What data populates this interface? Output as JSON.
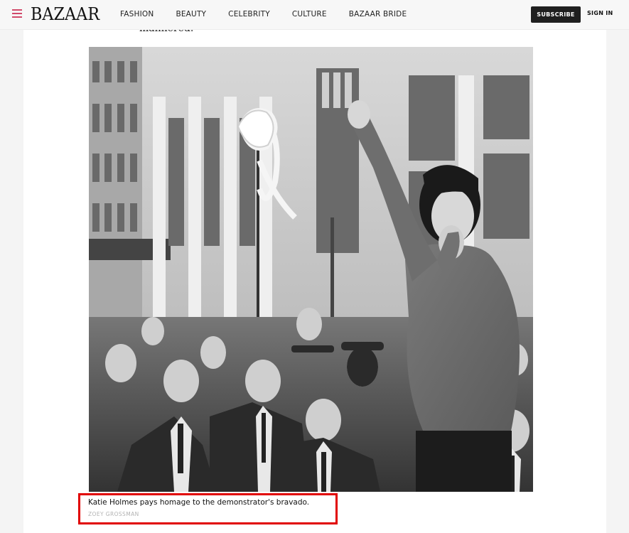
{
  "header": {
    "logo": "BAZAAR",
    "nav": [
      "FASHION",
      "BEAUTY",
      "CELEBRITY",
      "CULTURE",
      "BAZAAR BRIDE"
    ],
    "subscribe_label": "SUBSCRIBE",
    "sign_in_label": "SIGN IN",
    "accent_color": "#d14a6b"
  },
  "article": {
    "prev_text_fragment": "mannered.",
    "caption": "Katie Holmes pays homage to the demonstrator's bravado.",
    "photo_credit": "ZOEY GROSSMAN"
  },
  "highlight_color": "#e10000"
}
